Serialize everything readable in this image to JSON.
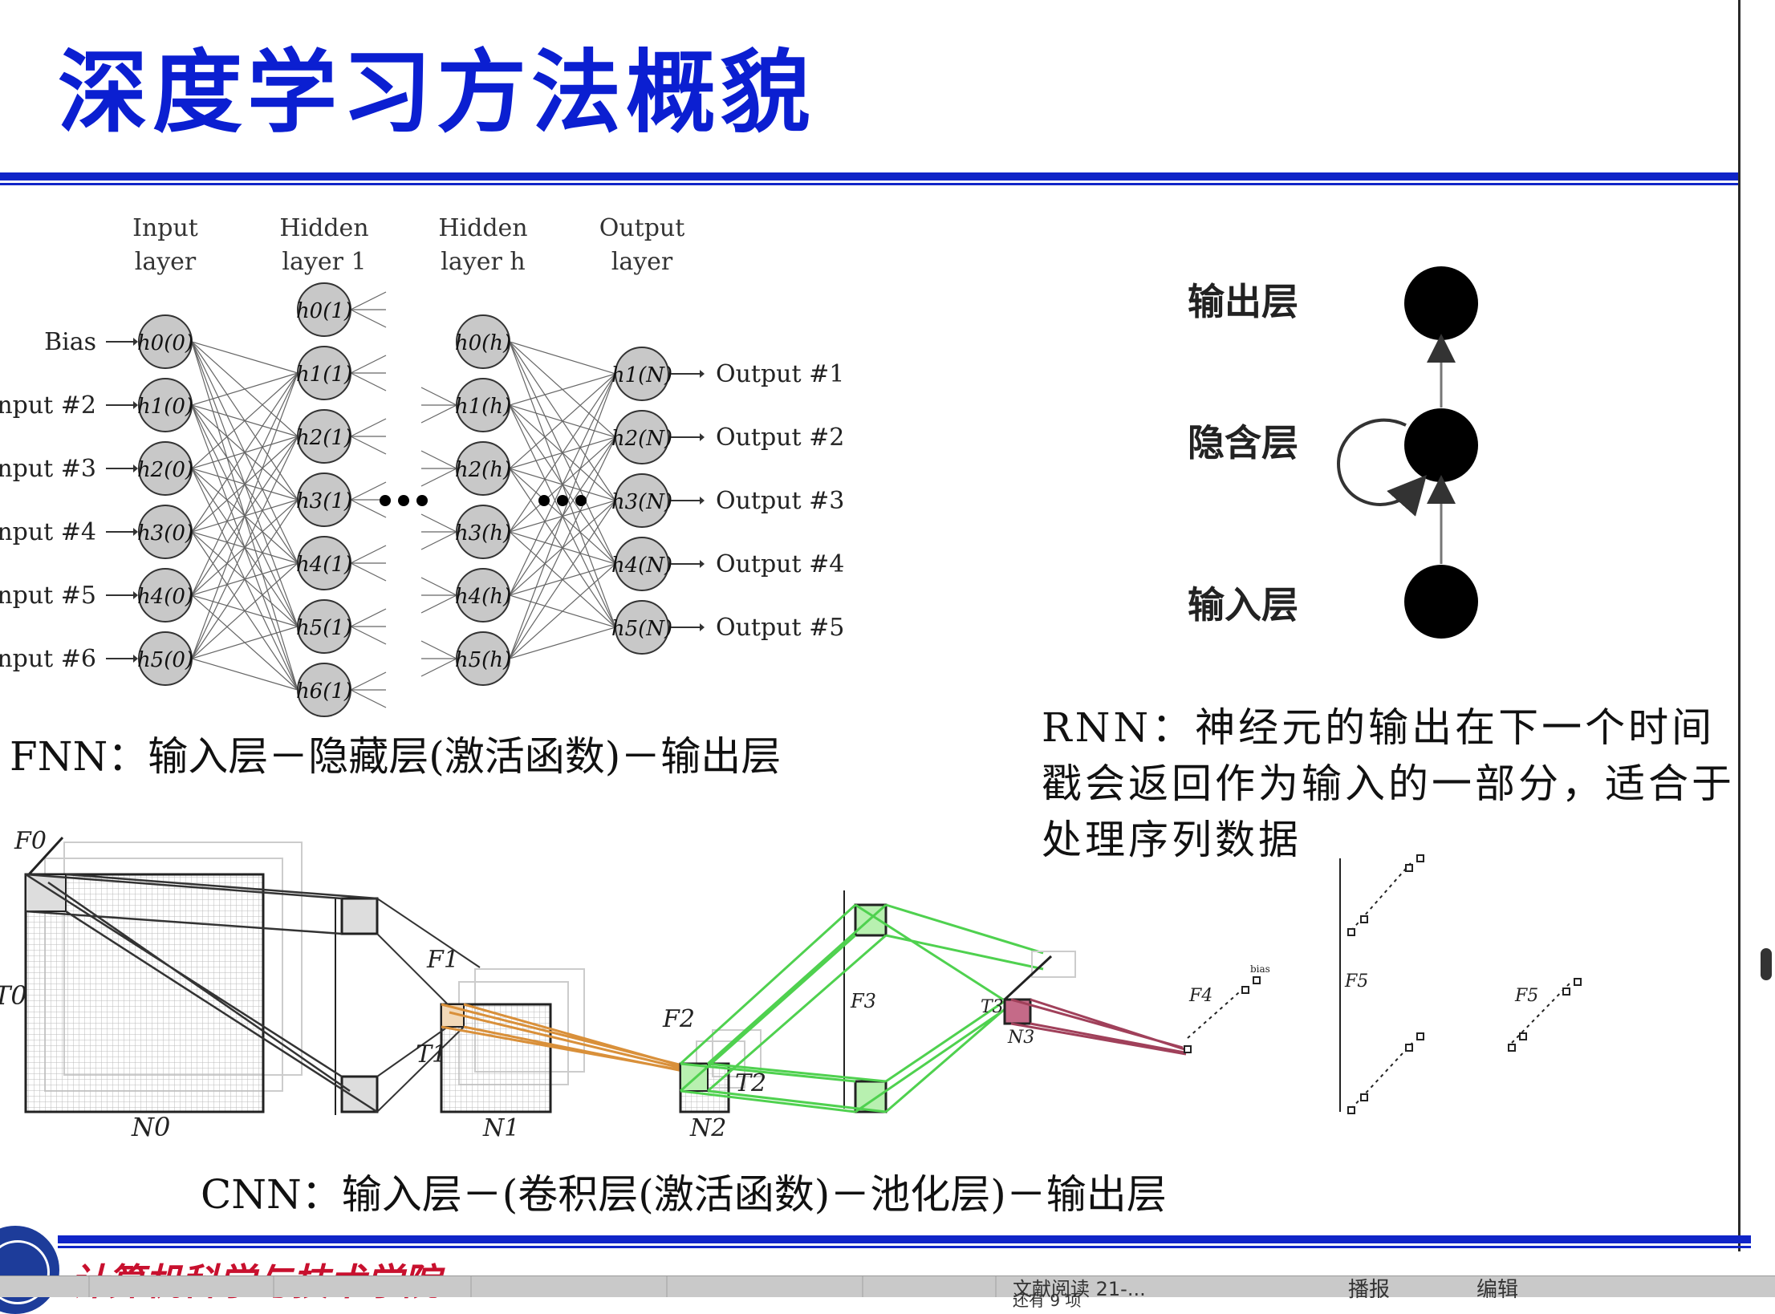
{
  "title": "深度学习方法概貌",
  "fnn": {
    "headers": [
      "Input\nlayer",
      "Hidden\nlayer 1",
      "Hidden\nlayer h",
      "Output\nlayer"
    ],
    "header_lines": [
      [
        "Input",
        "layer"
      ],
      [
        "Hidden",
        "layer 1"
      ],
      [
        "Hidden",
        "layer h"
      ],
      [
        "Output",
        "layer"
      ]
    ],
    "inputs": [
      "Bias",
      "nput #2",
      "nput #3",
      "nput #4",
      "nput #5",
      "nput #6"
    ],
    "input_nodes": [
      "h0(0)",
      "h1(0)",
      "h2(0)",
      "h3(0)",
      "h4(0)",
      "h5(0)"
    ],
    "hidden1_nodes": [
      "h0(1)",
      "h1(1)",
      "h2(1)",
      "h3(1)",
      "h4(1)",
      "h5(1)",
      "h6(1)"
    ],
    "hiddenh_nodes": [
      "h0(h)",
      "h1(h)",
      "h2(h)",
      "h3(h)",
      "h4(h)",
      "h5(h)"
    ],
    "output_nodes": [
      "h1(N)",
      "h2(N)",
      "h3(N)",
      "h4(N)",
      "h5(N)"
    ],
    "outputs": [
      "Output #1",
      "Output #2",
      "Output #3",
      "Output #4",
      "Output #5"
    ],
    "caption": "FNN：输入层－隐藏层(激活函数)－输出层"
  },
  "rnn": {
    "labels": {
      "output": "输出层",
      "hidden": "隐含层",
      "input": "输入层"
    },
    "caption": "RNN：神经元的输出在下一个时间戳会返回作为输入的一部分，适合于处理序列数据"
  },
  "cnn": {
    "labels": {
      "F0": "F0",
      "T0": "T0",
      "N0": "N0",
      "F1": "F1",
      "T1": "T1",
      "N1": "N1",
      "F2": "F2",
      "T2": "T2",
      "N2": "N2",
      "F3": "F3",
      "T3": "T3",
      "N3": "N3",
      "F4": "F4",
      "F5a": "F5",
      "F5b": "F5",
      "bias": "bias"
    },
    "caption": "CNN：输入层－(卷积层(激活函数)－池化层)－输出层"
  },
  "footer": {
    "school": "计算机科学与技术学院",
    "taskbar": [
      "文献阅读 21-...",
      "还有 9 项",
      "播报",
      "编辑"
    ]
  },
  "colors": {
    "title": "#0b1fd1",
    "rule": "#1025c8",
    "school": "#c8102e",
    "node": "#c8c8c8",
    "green": "#4fd14f",
    "orange": "#d9903a",
    "pink": "#a0405a"
  }
}
